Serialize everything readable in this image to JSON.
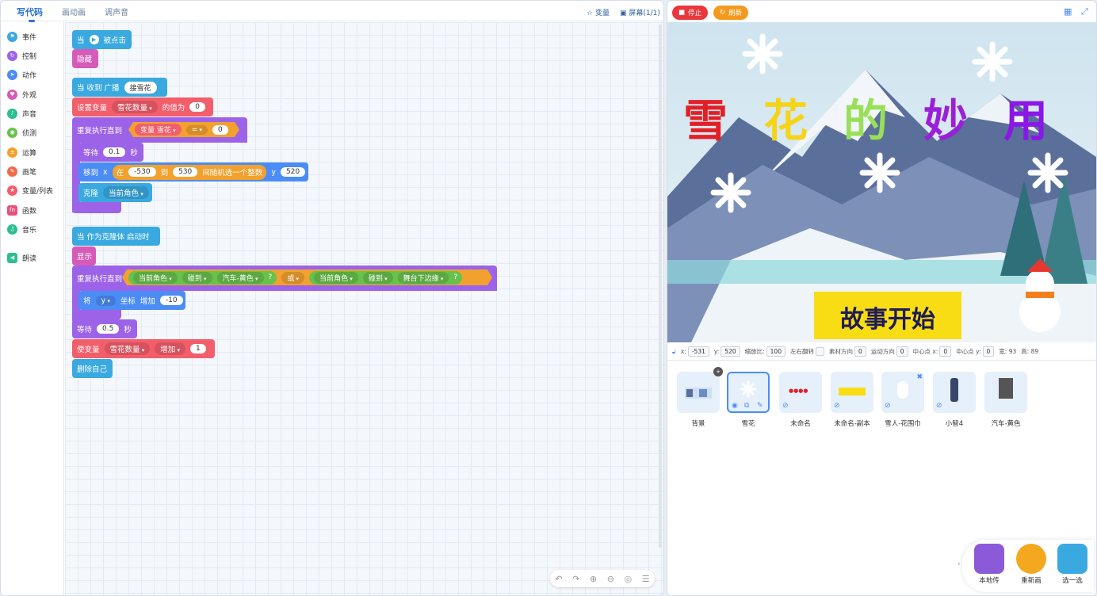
{
  "tabs": [
    "写代码",
    "画动画",
    "调声音"
  ],
  "toolbar": {
    "variables": "变量",
    "screen": "屏幕(1/1)"
  },
  "categories": [
    {
      "label": "事件",
      "color": "#3aa9e0"
    },
    {
      "label": "控制",
      "color": "#9c63e8"
    },
    {
      "label": "动作",
      "color": "#4b8cf5"
    },
    {
      "label": "外观",
      "color": "#d65bb8"
    },
    {
      "label": "声音",
      "color": "#2bbf8f"
    },
    {
      "label": "侦测",
      "color": "#68c14c"
    },
    {
      "label": "运算",
      "color": "#f2a12e"
    },
    {
      "label": "画笔",
      "color": "#f06a4b"
    },
    {
      "label": "变量/列表",
      "color": "#f35e6b"
    },
    {
      "label": "函数",
      "color": "#e8507a"
    },
    {
      "label": "音乐",
      "color": "#2bbf8f"
    },
    {
      "label": "朗读",
      "color": "#2bbf8f"
    }
  ],
  "script1": {
    "when": "当",
    "clicked": "被点击",
    "hide": "隐藏"
  },
  "script2": {
    "when_receive": "当 收到 广播",
    "broadcast": "接雪花",
    "set_var": "设置变量",
    "var_name": "雪花数量",
    "value_is": "的值为",
    "value": "0",
    "repeat_until": "重复执行直到",
    "var_label": "变量",
    "var2": "雪花",
    "eq": "=",
    "eq_val": "0",
    "wait": "等待",
    "wait_val": "0.1",
    "sec": "秒",
    "move_to": "移到",
    "x": "x",
    "rand_in": "在",
    "rand_from": "-530",
    "rand_to_label": "到",
    "rand_to": "530",
    "rand_pick": "间随机选一个整数",
    "y": "y",
    "y_val": "520",
    "clone": "克隆",
    "clone_target": "当前角色"
  },
  "script3": {
    "when_clone": "当 作为克隆体 启动时",
    "show": "显示",
    "repeat_until": "重复执行直到",
    "cur": "当前角色",
    "touch": "碰到",
    "car": "汽车-黄色",
    "q": "?",
    "or": "或",
    "cur2": "当前角色",
    "touch2": "碰到",
    "edge": "舞台下边缘",
    "q2": "?",
    "change": "将",
    "axis": "y",
    "coord": "坐标",
    "inc": "增加",
    "inc_val": "-10",
    "wait": "等待",
    "wait_val": "0.5",
    "sec": "秒",
    "change_var": "使变量",
    "var_name": "雪花数量",
    "add": "增加",
    "add_val": "1",
    "delete": "删除自己"
  },
  "stage": {
    "stop": "停止",
    "refresh": "刷新",
    "title_chars": [
      "雪",
      "花",
      "的",
      "妙",
      "用"
    ],
    "title_colors": [
      "#e31f26",
      "#f5d418",
      "#9adf5a",
      "#9b1fd8",
      "#8a17e8"
    ],
    "banner": "故事开始"
  },
  "props": {
    "x_label": "x:",
    "x": "-531",
    "y_label": "y:",
    "y": "520",
    "scale_label": "缩放比:",
    "scale": "100",
    "flip_label": "左右翻转",
    "mat_dir_label": "素材方向",
    "mat_dir": "0",
    "move_dir_label": "运动方向",
    "move_dir": "0",
    "cx_label": "中心点 x:",
    "cx": "0",
    "cy_label": "中心点 y:",
    "cy": "0",
    "w_label": "宽: 93",
    "h_label": "高: 89"
  },
  "sprites": [
    {
      "name": "背景"
    },
    {
      "name": "雪花"
    },
    {
      "name": "未命名"
    },
    {
      "name": "未命名-副本"
    },
    {
      "name": "雪人-花围巾"
    },
    {
      "name": "小智4"
    },
    {
      "name": "汽车-黄色"
    }
  ],
  "background_badge": "+",
  "tools": {
    "local": "本地传",
    "redraw": "重新画",
    "pick": "选一选"
  }
}
